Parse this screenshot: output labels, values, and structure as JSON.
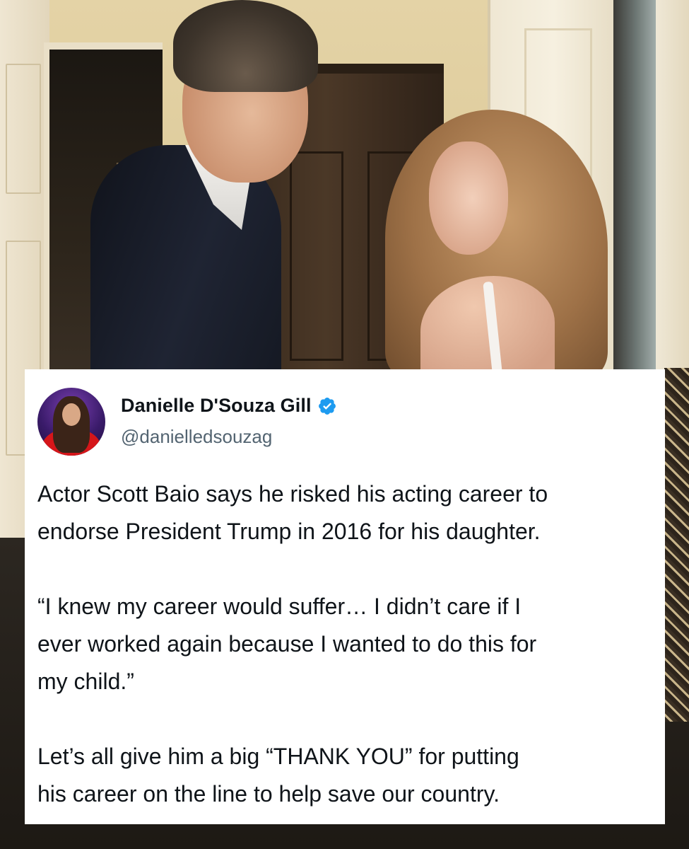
{
  "tweet": {
    "author_name": "Danielle D'Souza Gill",
    "handle": "@danielledsouzag",
    "verified_badge_color": "#1d9bf0",
    "paragraphs": [
      "Actor Scott Baio says he risked his acting career to\nendorse President Trump in 2016 for his daughter.",
      "“I knew my career would suffer… I didn’t care if I\never worked again because I wanted to do this for\nmy child.”",
      "Let’s all give him a big “THANK YOU” for putting\nhis career on the line to help save our country."
    ]
  },
  "icons": {
    "verified": "verified-badge-icon"
  },
  "colors": {
    "card_background": "#ffffff",
    "text_primary": "#0f1419",
    "text_secondary": "#536471"
  }
}
